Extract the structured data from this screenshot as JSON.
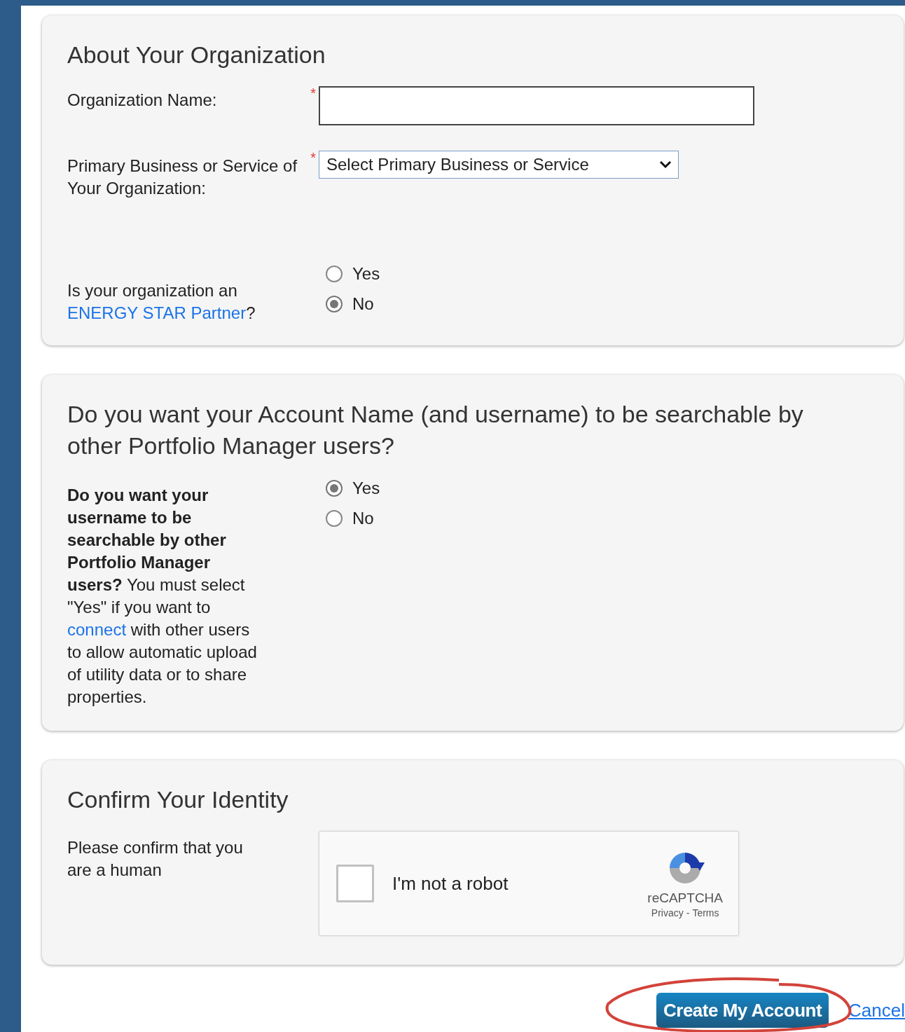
{
  "sections": [
    {
      "title": "About Your Organization",
      "fields": [
        {
          "kind": "text",
          "label": [
            {
              "kind": "text",
              "text": "Organization Name:"
            }
          ],
          "required_mark": "*"
        },
        {
          "kind": "select",
          "label": [
            {
              "kind": "text",
              "text": "Primary Business or Service of Your Organization:"
            }
          ],
          "required_mark": "*",
          "value": "Select Primary Business or Service"
        },
        {
          "kind": "radio",
          "label": [
            {
              "kind": "text",
              "text": "Is your organization an "
            },
            {
              "kind": "link",
              "text": "ENERGY STAR Partner"
            },
            {
              "kind": "text",
              "text": "?"
            }
          ],
          "options": [
            {
              "label": "Yes",
              "selected": false
            },
            {
              "label": "No",
              "selected": true
            }
          ]
        }
      ]
    },
    {
      "title": "Do you want your Account Name (and username) to be searchable by other Portfolio Manager users?",
      "fields": [
        {
          "kind": "radio",
          "label": [
            {
              "kind": "bold",
              "text": "Do you want your username to be searchable by other Portfolio Manager users?"
            },
            {
              "kind": "text",
              "text": " You must select \"Yes\" if you want to "
            },
            {
              "kind": "link",
              "text": "connect"
            },
            {
              "kind": "text",
              "text": " with other users to allow automatic upload of utility data or to share properties."
            }
          ],
          "options": [
            {
              "label": "Yes",
              "selected": true
            },
            {
              "label": "No",
              "selected": false
            }
          ]
        }
      ]
    },
    {
      "title": "Confirm Your Identity",
      "fields": [
        {
          "kind": "captcha",
          "label": [
            {
              "kind": "text",
              "text": "Please confirm that you are a human"
            }
          ],
          "captcha": {
            "label": "I'm not a robot",
            "checked": false,
            "brand": "reCAPTCHA",
            "privacy": "Privacy",
            "separator": "-",
            "terms": "Terms"
          }
        }
      ]
    }
  ],
  "actions": {
    "submit": "Create My Account",
    "cancel": "Cancel",
    "submit_circled": true
  }
}
